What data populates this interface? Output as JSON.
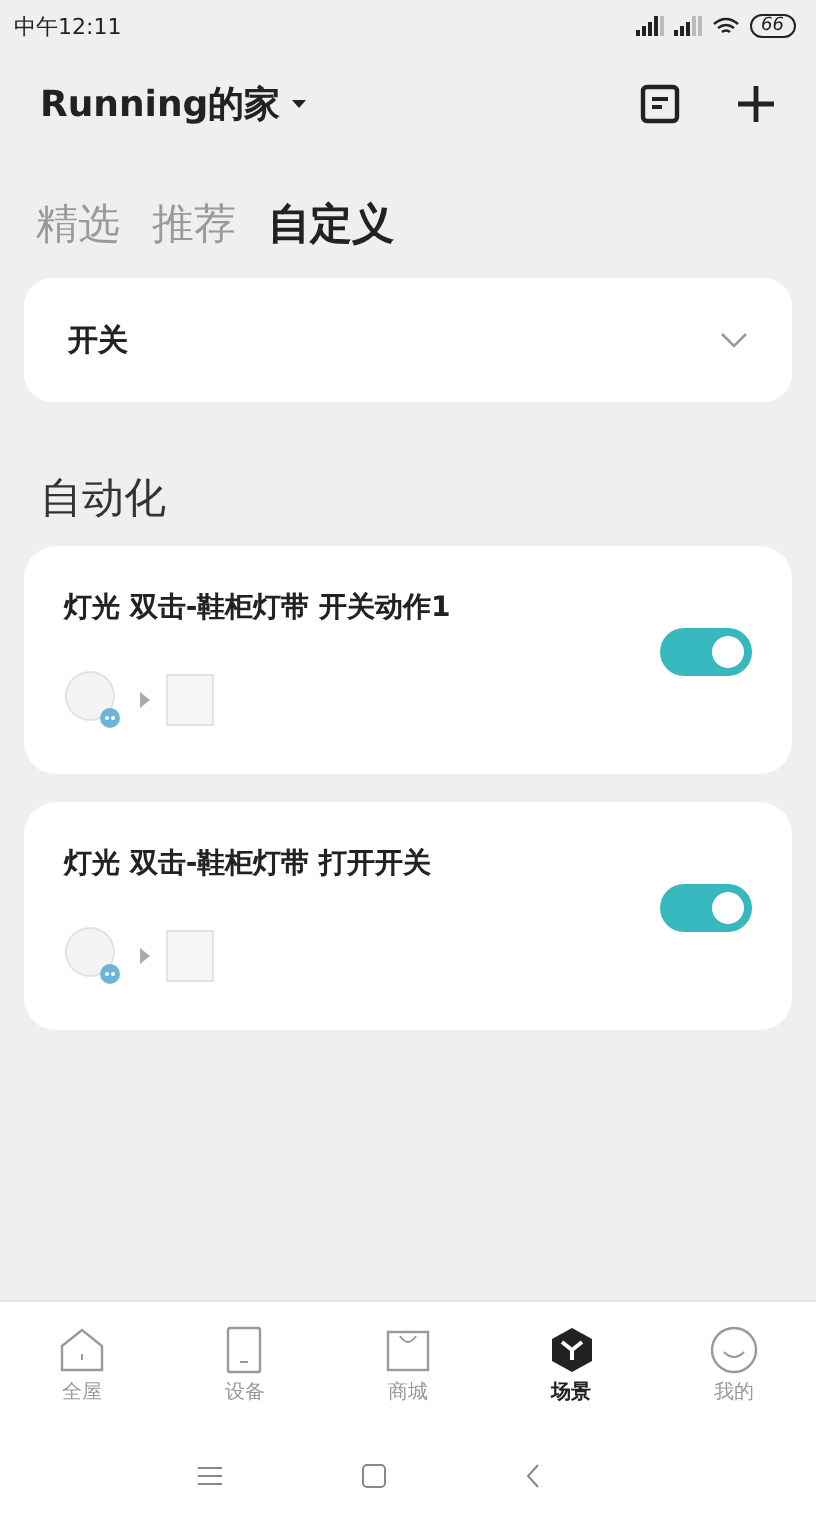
{
  "status_bar": {
    "time": "中午12:11",
    "battery": "66"
  },
  "header": {
    "title": "Running的家"
  },
  "tabs": [
    {
      "label": "精选",
      "selected": false
    },
    {
      "label": "推荐",
      "selected": false
    },
    {
      "label": "自定义",
      "selected": true
    }
  ],
  "filter": {
    "label": "开关"
  },
  "section_title": "自动化",
  "automations": [
    {
      "name": "灯光 双击-鞋柜灯带 开关动作1",
      "on": true
    },
    {
      "name": "灯光 双击-鞋柜灯带 打开开关",
      "on": true
    }
  ],
  "bottom_nav": [
    {
      "label": "全屋",
      "kind": "home",
      "selected": false
    },
    {
      "label": "设备",
      "kind": "device",
      "selected": false
    },
    {
      "label": "商城",
      "kind": "shop",
      "selected": false
    },
    {
      "label": "场景",
      "kind": "scene",
      "selected": true
    },
    {
      "label": "我的",
      "kind": "me",
      "selected": false
    }
  ]
}
